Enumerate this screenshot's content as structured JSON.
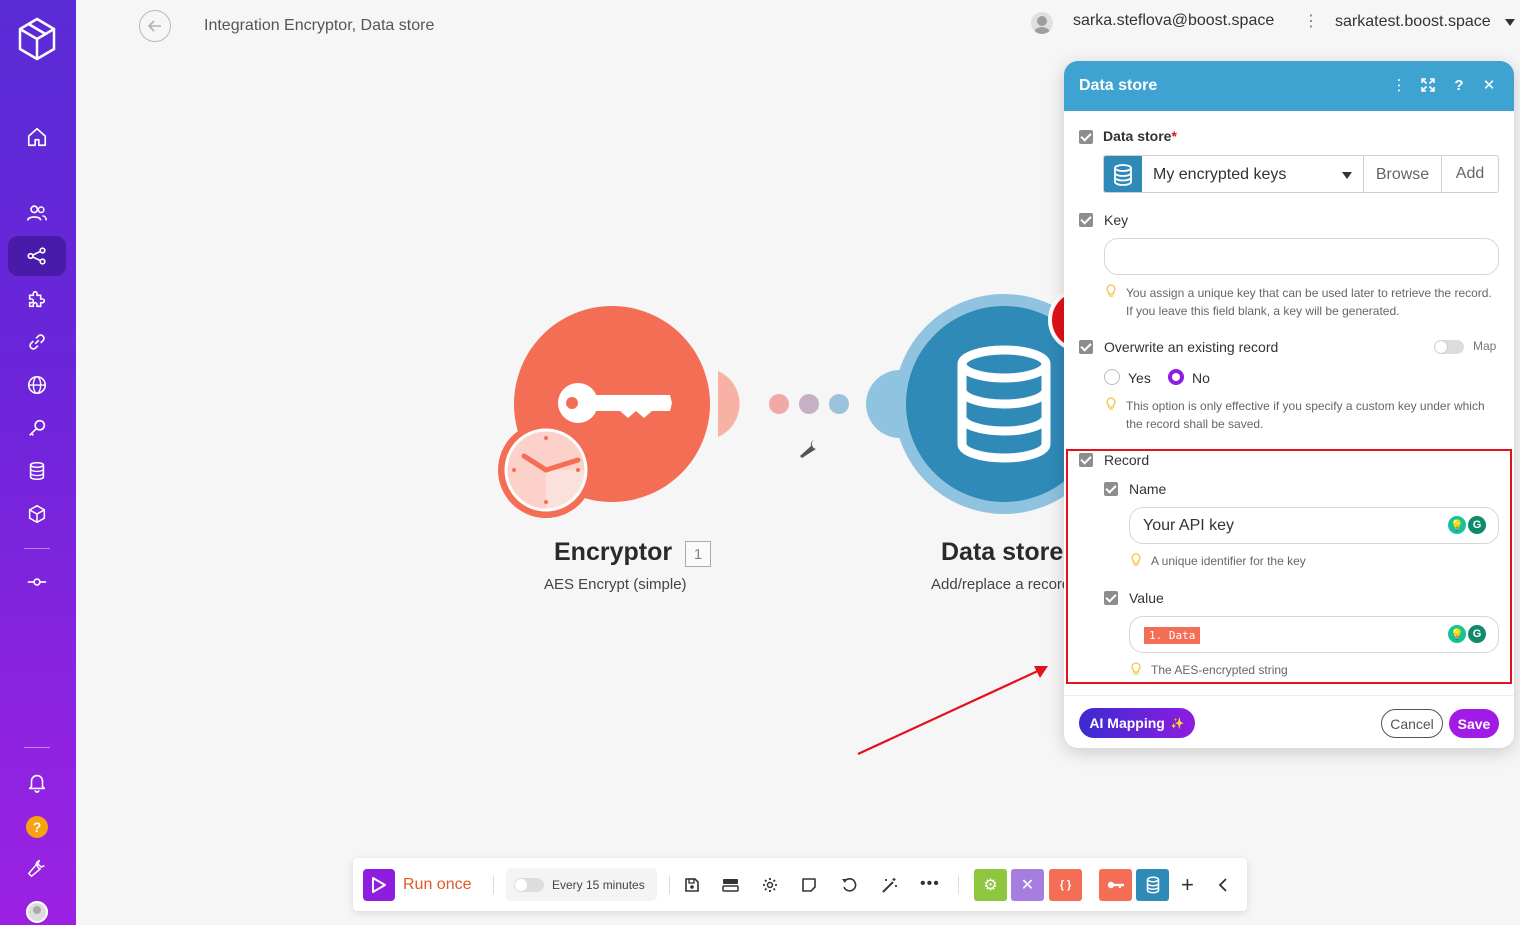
{
  "sidebar": {
    "items": [
      "home-icon",
      "team-icon",
      "scenarios-icon",
      "apps-icon",
      "connections-icon",
      "webhooks-icon",
      "keys-icon",
      "datastores-icon",
      "datastructures-icon",
      "devices-icon",
      "notifications-icon",
      "help-icon",
      "tools-icon",
      "profile-avatar"
    ],
    "help_badge": "?"
  },
  "header": {
    "breadcrumb": "Integration Encryptor, Data store",
    "user_email": "sarka.steflova@boost.space",
    "org_name": "sarkatest.boost.space"
  },
  "canvas": {
    "modules": [
      {
        "name": "Encryptor",
        "badge": "1",
        "subtitle": "AES Encrypt (simple)",
        "color": "#f46d55"
      },
      {
        "name": "Data store",
        "subtitle": "Add/replace a record",
        "color": "#2f8ab8"
      }
    ]
  },
  "panel": {
    "title": "Data store",
    "datastore": {
      "label": "Data store",
      "required_mark": "*",
      "selected": "My encrypted keys",
      "browse_label": "Browse",
      "add_label": "Add"
    },
    "key": {
      "label": "Key",
      "value": "",
      "hint": "You assign a unique key that can be used later to retrieve the record. If you leave this field blank, a key will be generated."
    },
    "overwrite": {
      "label": "Overwrite an existing record",
      "map_label": "Map",
      "yes_label": "Yes",
      "no_label": "No",
      "selected": "No",
      "hint": "This option is only effective if you specify a custom key under which the record shall be saved."
    },
    "record": {
      "label": "Record",
      "name": {
        "label": "Name",
        "value": "Your API key",
        "hint": "A unique identifier for the key"
      },
      "value": {
        "label": "Value",
        "pill": "1. Data",
        "hint": "The AES-encrypted string"
      }
    },
    "footer": {
      "ai_mapping_label": "AI Mapping",
      "cancel_label": "Cancel",
      "save_label": "Save"
    }
  },
  "toolbar": {
    "run_once_label": "Run once",
    "schedule_label": "Every 15 minutes",
    "app_colors": [
      "#8dc63f",
      "#a57ee0",
      "#f46d55",
      "#f46d55",
      "#2f8ab8"
    ]
  },
  "colors": {
    "accent": "#8e1de0",
    "panel_header": "#3fa3d2",
    "highlight": "#e3111b"
  }
}
